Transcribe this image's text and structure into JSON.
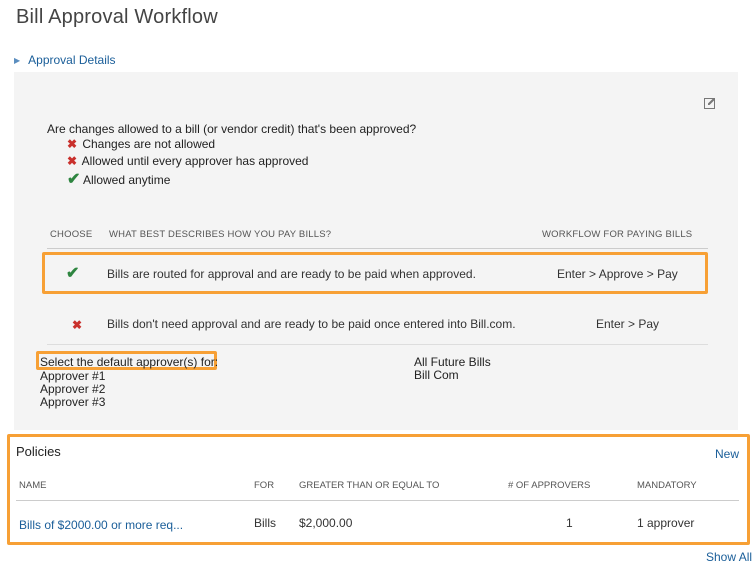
{
  "page": {
    "title": "Bill Approval Workflow"
  },
  "approval_details": {
    "toggle_label": "Approval Details"
  },
  "changes": {
    "question": "Are changes allowed to a bill (or vendor credit) that's been approved?",
    "options": [
      {
        "icon": "x-icon",
        "label": "Changes are not allowed"
      },
      {
        "icon": "x-icon",
        "label": "Allowed until every approver has approved"
      },
      {
        "icon": "check-icon",
        "label": "Allowed anytime"
      }
    ]
  },
  "workflow": {
    "headers": {
      "choose": "CHOOSE",
      "describe": "WHAT BEST DESCRIBES HOW YOU PAY BILLS?",
      "workflow": "WORKFLOW FOR PAYING BILLS"
    },
    "rows": [
      {
        "icon": "check-icon",
        "description": "Bills are routed for approval and are ready to be paid when approved.",
        "workflow": "Enter > Approve > Pay",
        "selected": true
      },
      {
        "icon": "x-icon",
        "description": "Bills don't need approval and are ready to be paid once entered into Bill.com.",
        "workflow": "Enter > Pay",
        "selected": false
      }
    ]
  },
  "default_approvers": {
    "label": "Select the default approver(s) for:",
    "approvers": [
      "Approver #1",
      "Approver #2",
      "Approver #3"
    ],
    "scope": [
      "All Future Bills",
      "Bill Com"
    ]
  },
  "policies": {
    "title": "Policies",
    "new_label": "New",
    "headers": {
      "name": "NAME",
      "for": "FOR",
      "gte": "GREATER THAN OR EQUAL TO",
      "num": "# OF APPROVERS",
      "mandatory": "MANDATORY"
    },
    "rows": [
      {
        "name": "Bills of $2000.00 or more req...",
        "for": "Bills",
        "gte": "$2,000.00",
        "num": "1",
        "mandatory": "1 approver"
      }
    ],
    "show_all_label": "Show All"
  },
  "colors": {
    "accent_link": "#1a5e99",
    "highlight": "#f7a035",
    "check": "#2e8540",
    "x": "#c9302c"
  }
}
